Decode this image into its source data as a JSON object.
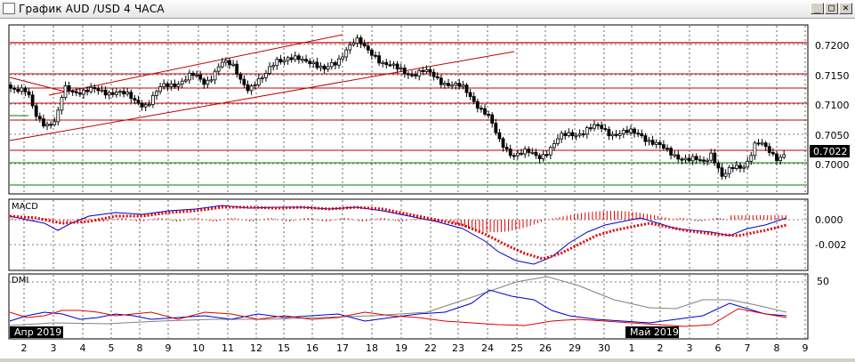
{
  "window": {
    "title": "График AUD /USD  4 ЧАСА",
    "buttons": {
      "minimize": "_",
      "maximize": "□",
      "close": "✕"
    }
  },
  "price_panel": {
    "y_ticks": [
      "0.7200",
      "0.7150",
      "0.7100",
      "0.7050",
      "0.7000"
    ],
    "current_price": "0.7022"
  },
  "macd_panel": {
    "label": "MACD",
    "y_ticks": [
      "0.000",
      "-0.002"
    ]
  },
  "dmi_panel": {
    "label": "DMI",
    "y_ticks": [
      "50"
    ]
  },
  "time_axis": {
    "month_tags": [
      "Апр 2019",
      "Май 2019"
    ],
    "day_labels": [
      "2",
      "3",
      "4",
      "5",
      "8",
      "9",
      "10",
      "11",
      "12",
      "15",
      "16",
      "17",
      "18",
      "19",
      "22",
      "23",
      "24",
      "25",
      "26",
      "29",
      "30",
      "1",
      "2",
      "3",
      "6",
      "7",
      "8",
      "9"
    ]
  },
  "colors": {
    "candle": "#000000",
    "red_level": "#c00000",
    "green_level": "#008000",
    "macd_line": "#0000cc",
    "macd_signal": "#e00000",
    "dmi_plus": "#0000cc",
    "dmi_minus": "#e00000",
    "adx": "#808080"
  }
}
